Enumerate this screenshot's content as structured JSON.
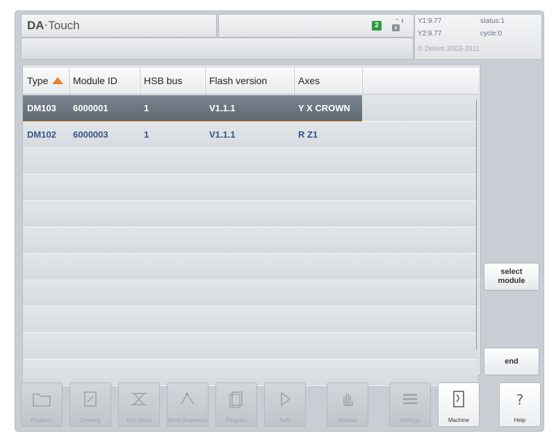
{
  "header": {
    "brand_bold": "DA",
    "brand_sep": "·",
    "brand_rest": "Touch",
    "badge": "2",
    "info": {
      "y1": "Y1:9.77",
      "y2": "Y2:9.77",
      "status": "status:1",
      "cycle": "cycle:0",
      "copyright": "© Delem 2003-2011"
    }
  },
  "table": {
    "columns": [
      "Type",
      "Module ID",
      "HSB bus",
      "Flash version",
      "Axes"
    ],
    "sort_column": "Type",
    "rows": [
      [
        "DM103",
        "6000001",
        "1",
        "V1.1.1",
        "Y X CROWN"
      ],
      [
        "DM102",
        "6000003",
        "1",
        "V1.1.1",
        "R Z1"
      ]
    ],
    "selected_row": 0
  },
  "side_buttons": {
    "select_module_line1": "select",
    "select_module_line2": "module",
    "end": "end"
  },
  "toolbar": {
    "items": [
      {
        "label": "Products",
        "icon": "folder-icon"
      },
      {
        "label": "Drawing",
        "icon": "drawing-icon"
      },
      {
        "label": "Tool Setup",
        "icon": "tool-setup-icon"
      },
      {
        "label": "Bend Sequence",
        "icon": "bend-sequence-icon"
      },
      {
        "label": "Program",
        "icon": "program-icon"
      },
      {
        "label": "Auto",
        "icon": "play-icon"
      },
      {
        "label": "Manual",
        "icon": "hand-icon"
      },
      {
        "label": "Settings",
        "icon": "settings-icon"
      },
      {
        "label": "Machine",
        "icon": "machine-icon"
      },
      {
        "label": "Help",
        "icon": "help-icon"
      }
    ]
  },
  "colors": {
    "accent": "#e8802c",
    "row_text": "#35558a",
    "selected_row": "#6a7580",
    "badge": "#2d9b3e"
  }
}
